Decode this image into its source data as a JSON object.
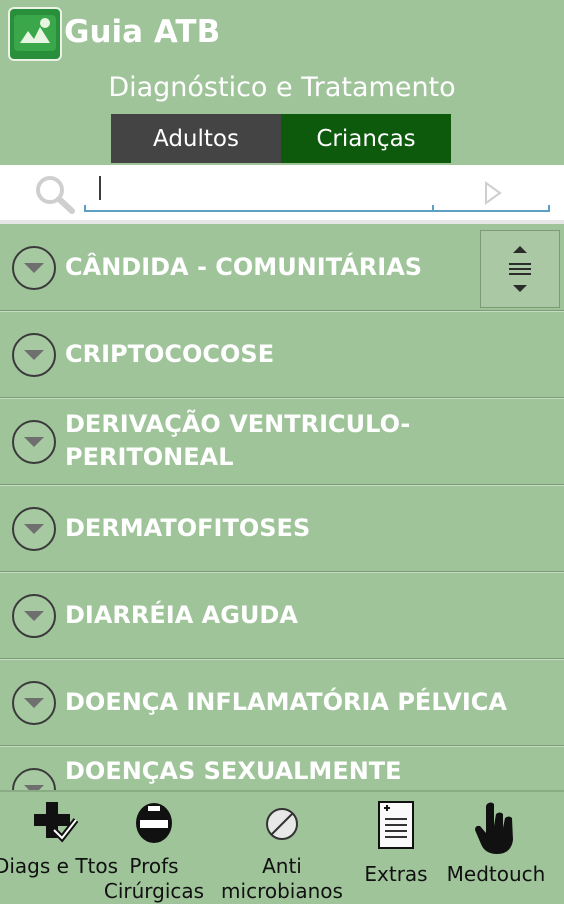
{
  "app": {
    "title": "Guia ATB",
    "subtitle": "Diagnóstico e Tratamento"
  },
  "tabs": {
    "adultos": "Adultos",
    "criancas": "Crianças",
    "selected": "Crianças"
  },
  "search": {
    "value": "",
    "placeholder": ""
  },
  "list": {
    "items": [
      "CÂNDIDA - COMUNITÁRIAS",
      "CRIPTOCOCOSE",
      "DERIVAÇÃO VENTRICULO-PERITONEAL",
      "DERMATOFITOSES",
      "DIARRÉIA AGUDA",
      "DOENÇA INFLAMATÓRIA PÉLVICA",
      "DOENÇAS SEXUALMENTE"
    ]
  },
  "bottom_nav": {
    "diags": "Diags e Ttos",
    "profs": "Profs Cirúrgicas",
    "anti": "Anti microbianos",
    "extras": "Extras",
    "medtouch": "Medtouch"
  },
  "colors": {
    "background": "#9fc49a",
    "tab_adultos": "#444444",
    "tab_criancas": "#0d5a0d",
    "search_underline": "#5e9fc4"
  }
}
